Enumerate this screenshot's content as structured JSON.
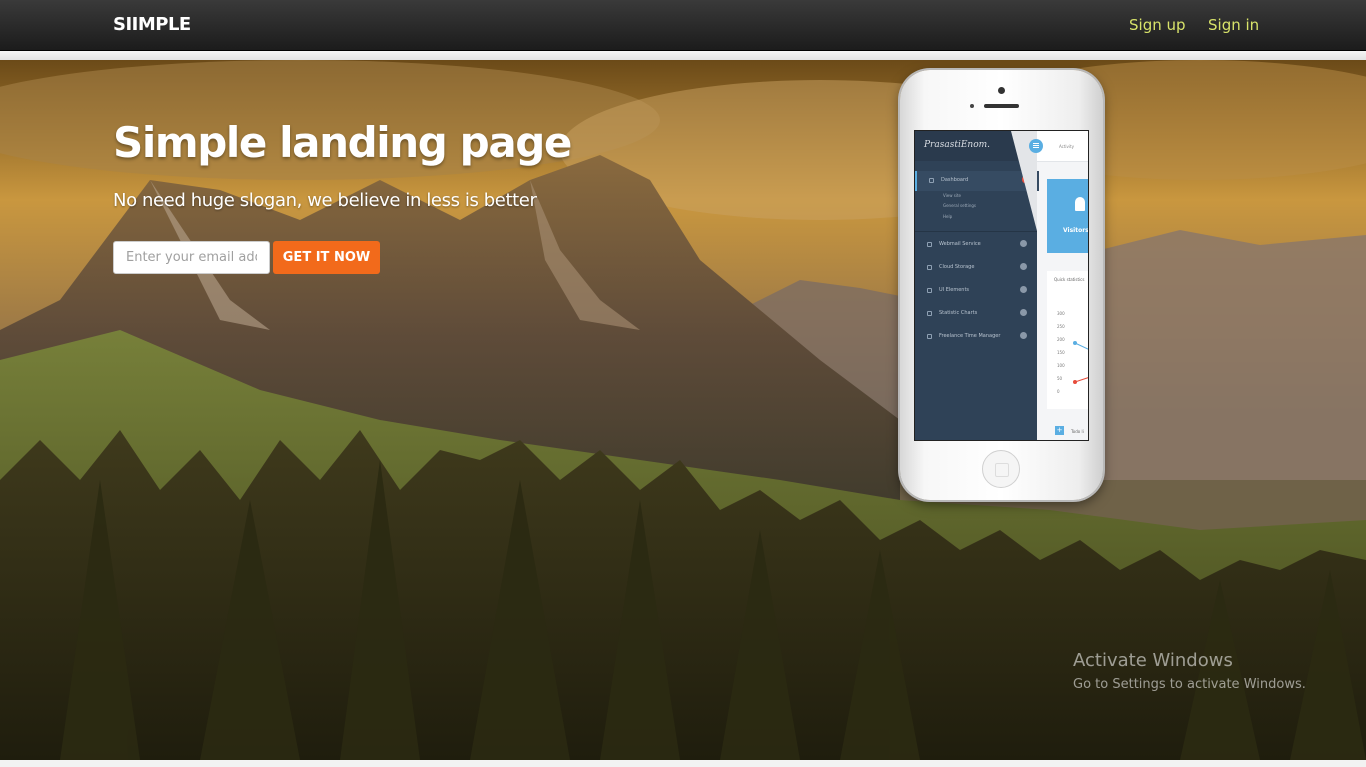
{
  "header": {
    "brand": "SIIMPLE",
    "nav": {
      "signup": "Sign up",
      "signin": "Sign in"
    }
  },
  "hero": {
    "title": "Simple landing page",
    "subtitle": "No need huge slogan, we believe in less is better",
    "email_placeholder": "Enter your email address",
    "cta_label": "GET IT NOW"
  },
  "phone_app": {
    "logo": "PrasastiEnom.",
    "top_tab": "Activity",
    "menu": [
      {
        "label": "Dashboard",
        "active": true,
        "badge_color": "#e74c3c"
      },
      {
        "label": "Webmail Service"
      },
      {
        "label": "Cloud Storage"
      },
      {
        "label": "UI Elements"
      },
      {
        "label": "Statistic Charts"
      },
      {
        "label": "Freelance Time Manager"
      }
    ],
    "submenu": [
      "View site",
      "General settings",
      "Help"
    ],
    "visitors_label": "Visitors",
    "stats_title": "Quick statistics",
    "axis_values": [
      "300",
      "250",
      "200",
      "150",
      "100",
      "50",
      "0"
    ],
    "todo_label": "Todo li"
  },
  "watermark": {
    "title": "Activate Windows",
    "subtitle": "Go to Settings to activate Windows."
  },
  "colors": {
    "accent": "#f26a1b",
    "nav_link": "#d8e36a",
    "app_sidebar": "#2f4257",
    "app_highlight": "#5aaee2"
  }
}
